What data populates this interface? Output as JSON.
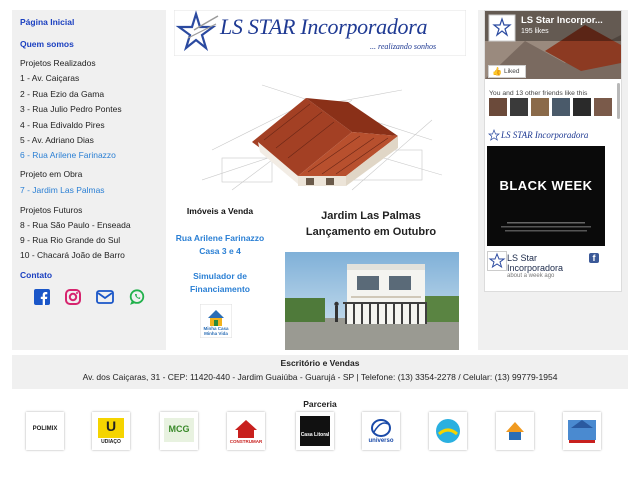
{
  "sidebar": {
    "home": "Página Inicial",
    "about": "Quem somos",
    "realizados_heading": "Projetos Realizados",
    "realizados": [
      "1 - Av. Caiçaras",
      "2 - Rua Ezio da Gama",
      "3 - Rua Julio Pedro Pontes",
      "4 - Rua Edivaldo Pires",
      "5 - Av. Adriano Dias",
      "6 - Rua Arilene Farinazzo"
    ],
    "obra_heading": "Projeto em Obra",
    "obra": [
      "7 - Jardim Las Palmas"
    ],
    "futuros_heading": "Projetos Futuros",
    "futuros": [
      "8 - Rua São Paulo - Enseada",
      "9 - Rua Rio Grande do Sul",
      "10 - Chacará João de Barro"
    ],
    "contact": "Contato",
    "social_icons": [
      "facebook-icon",
      "instagram-icon",
      "email-icon",
      "whatsapp-icon"
    ]
  },
  "logo": {
    "text": "LS STAR Incorporadora",
    "tagline": "... realizando sonhos"
  },
  "center": {
    "imoveis_title": "Imóveis a Venda",
    "imovel_link_1": "Rua Arilene Farinazzo",
    "imovel_link_2": "Casa 3 e 4",
    "simulator_1": "Simulador de",
    "simulator_2": "Financiamento",
    "mcmv_text": "Minha Casa Minha Vida",
    "headline_1": "Jardim Las Palmas",
    "headline_2": "Lançamento em Outubro"
  },
  "facebook": {
    "page_name": "LS Star Incorpor...",
    "likes": "195 likes",
    "liked": "Liked",
    "friends_text": "You and 13 other friends like this",
    "post_banner": "BLACK WEEK",
    "page_name_2_line1": "LS Star",
    "page_name_2_line2": "Incorporadora",
    "time_ago": "about a week ago"
  },
  "footer": {
    "title": "Escritório e Vendas",
    "address": "Av. dos Caiçaras, 31 - CEP: 11420-440 - Jardim Guaiúba - Guarujá - SP | Telefone: (13) 3354-2278 / Celular: (13) 99779-1954"
  },
  "parceria": {
    "title": "Parceria",
    "partners": [
      "POLIMIX",
      "UDIAÇO",
      "MCG",
      "CONSTRUMAR",
      "Casa Litoral",
      "universo",
      "",
      "",
      ""
    ]
  },
  "colors": {
    "link_blue": "#1a3fc0",
    "light_blue": "#2a7fd4",
    "panel_gray": "#f0f0f0",
    "facebook_blue": "#3b5998"
  }
}
